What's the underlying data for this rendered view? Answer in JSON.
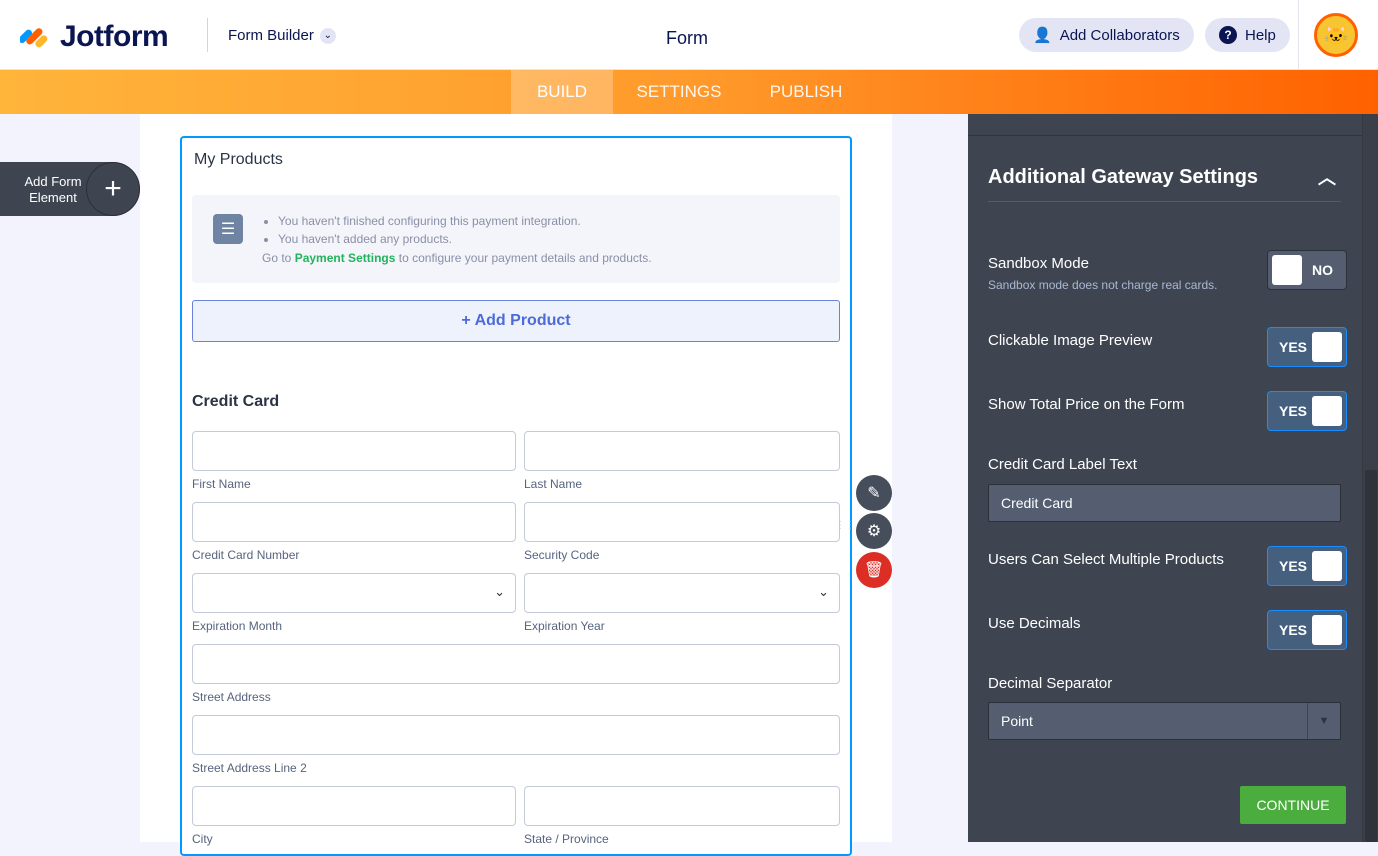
{
  "header": {
    "brand": "Jotform",
    "app_switcher": "Form Builder",
    "title": "Form",
    "add_collaborators": "Add Collaborators",
    "help": "Help"
  },
  "nav": {
    "tabs": [
      {
        "label": "BUILD",
        "active": true
      },
      {
        "label": "SETTINGS"
      },
      {
        "label": "PUBLISH"
      }
    ]
  },
  "left": {
    "add_element": "Add Form Element"
  },
  "form": {
    "widget_title": "My Products",
    "notice": {
      "items": [
        "You haven't finished configuring this payment integration.",
        "You haven't added any products."
      ],
      "go_prefix": "Go to",
      "go_link": "Payment Settings",
      "go_suffix": "to configure your payment details and products."
    },
    "add_product": "+ Add Product",
    "section": "Credit Card",
    "fields": {
      "first_name": "First Name",
      "last_name": "Last Name",
      "cc_number": "Credit Card Number",
      "security_code": "Security Code",
      "exp_month": "Expiration Month",
      "exp_year": "Expiration Year",
      "street": "Street Address",
      "street2": "Street Address Line 2",
      "city": "City",
      "state": "State / Province"
    }
  },
  "panel": {
    "title": "Additional Gateway Settings",
    "sandbox": {
      "label": "Sandbox Mode",
      "help": "Sandbox mode does not charge real cards.",
      "value": "NO"
    },
    "clickable_image": {
      "label": "Clickable Image Preview",
      "value": "YES"
    },
    "show_total": {
      "label": "Show Total Price on the Form",
      "value": "YES"
    },
    "cc_label": {
      "label": "Credit Card Label Text",
      "value": "Credit Card"
    },
    "multiple": {
      "label": "Users Can Select Multiple Products",
      "value": "YES"
    },
    "decimals": {
      "label": "Use Decimals",
      "value": "YES"
    },
    "separator": {
      "label": "Decimal Separator",
      "value": "Point"
    },
    "continue": "CONTINUE"
  }
}
